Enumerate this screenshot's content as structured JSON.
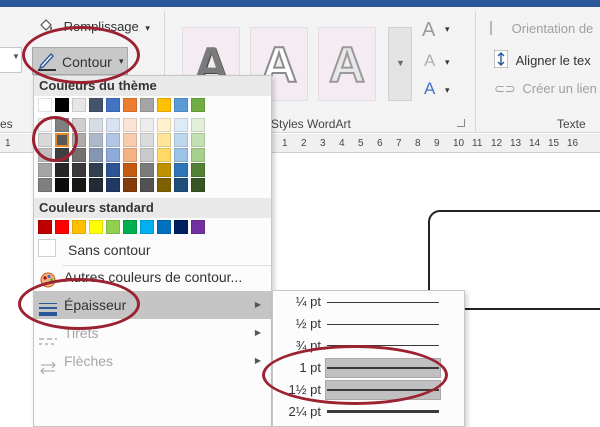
{
  "ribbon": {
    "remplissage": "Remplissage",
    "contour": "Contour",
    "caret": "▾",
    "group_partial": "es",
    "styles_wordart": "Styles WordArt",
    "texte": "Texte",
    "orientation": "Orientation de",
    "aligner": "Aligner le tex",
    "creer_lien": "Créer un lien",
    "wordart_letter": "A",
    "colors": {
      "accent": "#2b579a",
      "wordart_gray": "#888888",
      "wordart_blue": "#4472c4"
    }
  },
  "ruler": {
    "numbers": [
      "1",
      "2",
      "3",
      "4",
      "5",
      "6",
      "7",
      "8",
      "9",
      "10",
      "11",
      "12",
      "13",
      "14",
      "15",
      "16"
    ],
    "left_marker": "1"
  },
  "menu": {
    "theme_header": "Couleurs du thème",
    "standard_header": "Couleurs standard",
    "no_outline": "Sans contour",
    "other_colors": "Autres couleurs de contour...",
    "weight": "Épaisseur",
    "dashes": "Tirets",
    "arrows": "Flèches",
    "submenu_arrow": "▶",
    "theme_row": [
      "#ffffff",
      "#000000",
      "#e7e6e6",
      "#44546a",
      "#4472c4",
      "#ed7d31",
      "#a5a5a5",
      "#ffc000",
      "#5b9bd5",
      "#70ad47"
    ],
    "theme_grid": [
      [
        "#f2f2f2",
        "#7f7f7f",
        "#d0cece",
        "#d6dce4",
        "#d9e2f3",
        "#fbe4d5",
        "#ededed",
        "#fff2cc",
        "#deebf6",
        "#e2efd9"
      ],
      [
        "#d8d8d8",
        "#595959",
        "#aeabab",
        "#adb9ca",
        "#b4c6e7",
        "#f7cbac",
        "#dbdbdb",
        "#fee599",
        "#bdd7ee",
        "#c5e0b3"
      ],
      [
        "#bfbfbf",
        "#3f3f3f",
        "#757070",
        "#8496b0",
        "#8eaadb",
        "#f4b183",
        "#c9c9c9",
        "#ffd965",
        "#9cc3e5",
        "#a8d08d"
      ],
      [
        "#a5a5a5",
        "#262626",
        "#3a3838",
        "#323f4f",
        "#2f5496",
        "#c55a11",
        "#7b7b7b",
        "#bf9000",
        "#2e75b5",
        "#538135"
      ],
      [
        "#7f7f7f",
        "#0c0c0c",
        "#171616",
        "#222a35",
        "#1f3864",
        "#833c0b",
        "#525252",
        "#7f6000",
        "#1e4e79",
        "#375623"
      ]
    ],
    "standard_row": [
      "#c00000",
      "#ff0000",
      "#ffc000",
      "#ffff00",
      "#92d050",
      "#00b050",
      "#00b0f0",
      "#0070c0",
      "#002060",
      "#7030a0"
    ]
  },
  "submenu": {
    "weights": [
      {
        "label": "¼ pt"
      },
      {
        "label": "½ pt"
      },
      {
        "label": "¾ pt"
      },
      {
        "label": "1 pt"
      },
      {
        "label": "1½ pt"
      },
      {
        "label": "2¼ pt"
      }
    ]
  }
}
